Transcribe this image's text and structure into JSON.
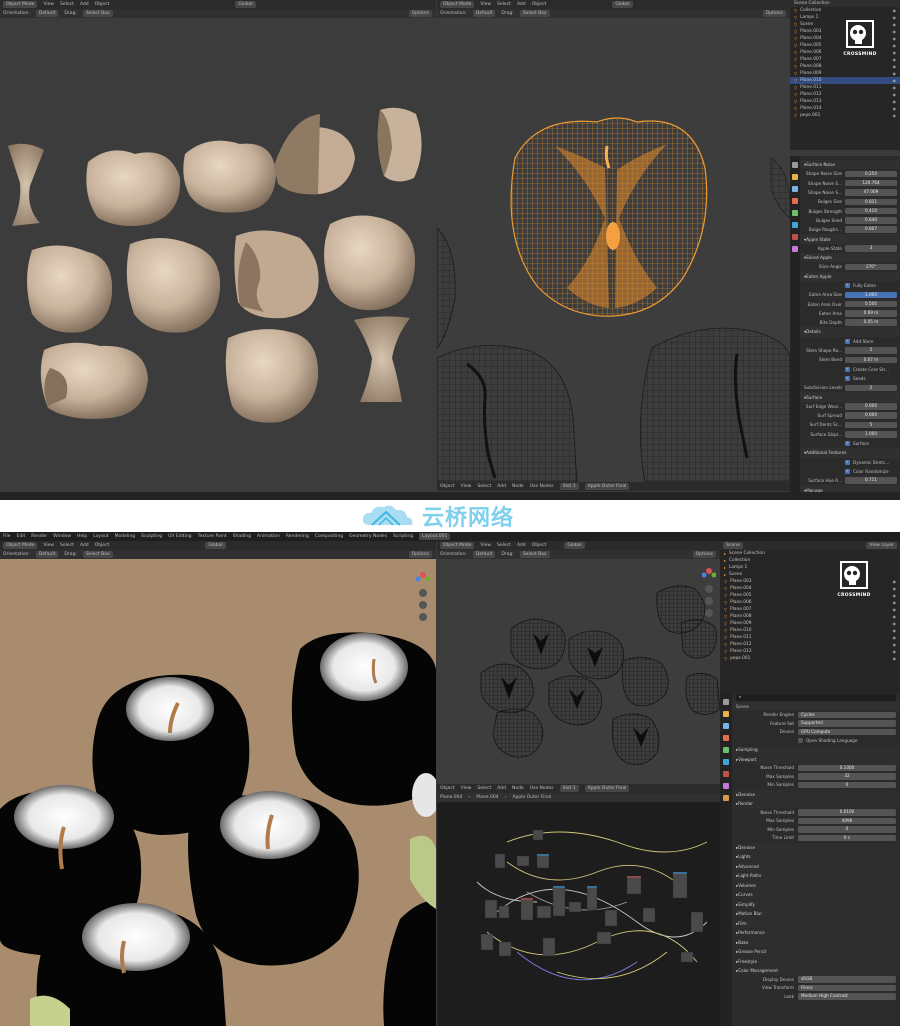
{
  "watermark": {
    "text": "云桥网络"
  },
  "logo": {
    "text": "CROSSMIND"
  },
  "top": {
    "left_header": [
      "Object Mode",
      "View",
      "Select",
      "Add",
      "Object"
    ],
    "left_sub": {
      "orientation": "Orientation:",
      "default": "Default",
      "drag": "Drag:",
      "select_box": "Select Box",
      "options": "Options"
    },
    "global": "Global",
    "right_header": [
      "Object Mode",
      "View",
      "Select",
      "Add",
      "Object"
    ],
    "scene_collection": "Scene Collection",
    "outliner": [
      "Collection",
      "Lamps 1",
      "Scene",
      "Plane.003",
      "Plane.004",
      "Plane.005",
      "Plane.006",
      "Plane.007",
      "Plane.008",
      "Plane.009",
      "Plane.010",
      "Plane.011",
      "Plane.012",
      "Plane.013",
      "Plane.014",
      "pepe.001"
    ],
    "props": [
      {
        "section": "Surface Noise"
      },
      {
        "label": "Shape Noise Size",
        "value": "0.250"
      },
      {
        "label": "Shape Noise S...",
        "value": "120.764"
      },
      {
        "label": "Shape Noise S...",
        "value": "47.009"
      },
      {
        "label": "Bulges Size",
        "value": "0.811"
      },
      {
        "label": "Bulges Strength",
        "value": "0.410"
      },
      {
        "label": "Bulges Seed",
        "value": "0.640"
      },
      {
        "label": "Bulge Roughn...",
        "value": "0.607"
      },
      {
        "section": "Apple State"
      },
      {
        "label": "Apple State",
        "value": "3"
      },
      {
        "section": "Sliced Apple"
      },
      {
        "label": "Slice Angle",
        "value": "270°"
      },
      {
        "section": "Eaten Apple"
      },
      {
        "check": "Fully Eaten"
      },
      {
        "label": "Eaten Area Size",
        "value": "1.000",
        "blue": true
      },
      {
        "label": "Eaten Area Over",
        "value": "0.500"
      },
      {
        "label": "Eaten Area",
        "value": "0.69 m"
      },
      {
        "label": "Bite Depth",
        "value": "0.05 m"
      },
      {
        "section": "Details"
      },
      {
        "check": "Add Stem"
      },
      {
        "label": "Stem Shape Ro...",
        "value": "5"
      },
      {
        "label": "Stem Bend",
        "value": "0.07 m"
      },
      {
        "check": "Create Core Str..."
      },
      {
        "check": "Seeds"
      },
      {
        "label": "Subdivision Levels",
        "value": "2"
      },
      {
        "section": "Surface"
      },
      {
        "label": "Surf Edge Wear...",
        "value": "0.000"
      },
      {
        "label": "Surf Spread",
        "value": "0.000"
      },
      {
        "label": "Surf Dents Sc...",
        "value": "5"
      },
      {
        "label": "Surface Displ...",
        "value": "1.000"
      },
      {
        "check": "Surface"
      },
      {
        "section": "Additional Features"
      },
      {
        "check": "Dynamic Stretc..."
      },
      {
        "check": "Color Randomize"
      },
      {
        "label": "Surface Hue R...",
        "value": "0.711"
      },
      {
        "section": "Manage"
      }
    ],
    "statusbar": [
      "Object",
      "View",
      "Select",
      "Add",
      "Node",
      "Use Nodes",
      "Slot 1",
      "Apple Outer Final"
    ]
  },
  "bottom": {
    "menu": [
      "File",
      "Edit",
      "Render",
      "Window",
      "Help",
      "Layout",
      "Modeling",
      "Sculpting",
      "UV Editing",
      "Texture Paint",
      "Shading",
      "Animation",
      "Rendering",
      "Compositing",
      "Geometry Nodes",
      "Scripting",
      "Layout.001"
    ],
    "scene": "Scene",
    "view_layer": "View Layer",
    "left_header": [
      "Object Mode",
      "View",
      "Select",
      "Add",
      "Object"
    ],
    "left_sub": {
      "orientation": "Orientation:",
      "default": "Default",
      "drag": "Drag:",
      "select_box": "Select Box",
      "options": "Options"
    },
    "global": "Global",
    "right_header": [
      "Object Mode",
      "View",
      "Select",
      "Add",
      "Object"
    ],
    "node_header": [
      "Object",
      "View",
      "Select",
      "Add",
      "Node",
      "Use Nodes",
      "Slot 1",
      "Apple Outer Final"
    ],
    "breadcrumb": [
      "Plane.004",
      "Plane.004",
      "Apple Outer Final"
    ],
    "outliner": [
      "Scene Collection",
      "Collection",
      "Lamps 1",
      "Scene",
      "Plane.003",
      "Plane.004",
      "Plane.005",
      "Plane.006",
      "Plane.007",
      "Plane.008",
      "Plane.009",
      "Plane.010",
      "Plane.011",
      "Plane.012",
      "Plane.013",
      "pepe.001"
    ],
    "render_title": "Scene",
    "render": [
      {
        "label": "Render Engine",
        "value": "Cycles"
      },
      {
        "label": "Feature Set",
        "value": "Supported"
      },
      {
        "label": "Device",
        "value": "GPU Compute"
      },
      {
        "check": "Open Shading Language"
      },
      {
        "section": "Sampling"
      },
      {
        "section": "Viewport"
      },
      {
        "label": "Noise Threshold",
        "value": "0.1000",
        "c": true
      },
      {
        "label": "Max Samples",
        "value": "32",
        "c": true
      },
      {
        "label": "Min Samples",
        "value": "0",
        "c": true
      },
      {
        "section": "Denoise"
      },
      {
        "section": "Render"
      },
      {
        "label": "Noise Threshold",
        "value": "0.0100",
        "c": true
      },
      {
        "label": "Max Samples",
        "value": "4096",
        "c": true
      },
      {
        "label": "Min Samples",
        "value": "0",
        "c": true
      },
      {
        "label": "Time Limit",
        "value": "0 s",
        "c": true
      },
      {
        "section": "Denoise"
      },
      {
        "section": "Lights"
      },
      {
        "section": "Advanced"
      },
      {
        "section": "Light Paths"
      },
      {
        "section": "Volumes"
      },
      {
        "section": "Curves"
      },
      {
        "section": "Simplify"
      },
      {
        "section": "Motion Blur"
      },
      {
        "section": "Film"
      },
      {
        "section": "Performance"
      },
      {
        "section": "Bake"
      },
      {
        "section": "Grease Pencil"
      },
      {
        "section": "Freestyle"
      },
      {
        "section": "Color Management"
      },
      {
        "label": "Display Device",
        "value": "sRGB"
      },
      {
        "label": "View Transform",
        "value": "Filmic"
      },
      {
        "label": "Look",
        "value": "Medium High Contrast"
      }
    ]
  }
}
